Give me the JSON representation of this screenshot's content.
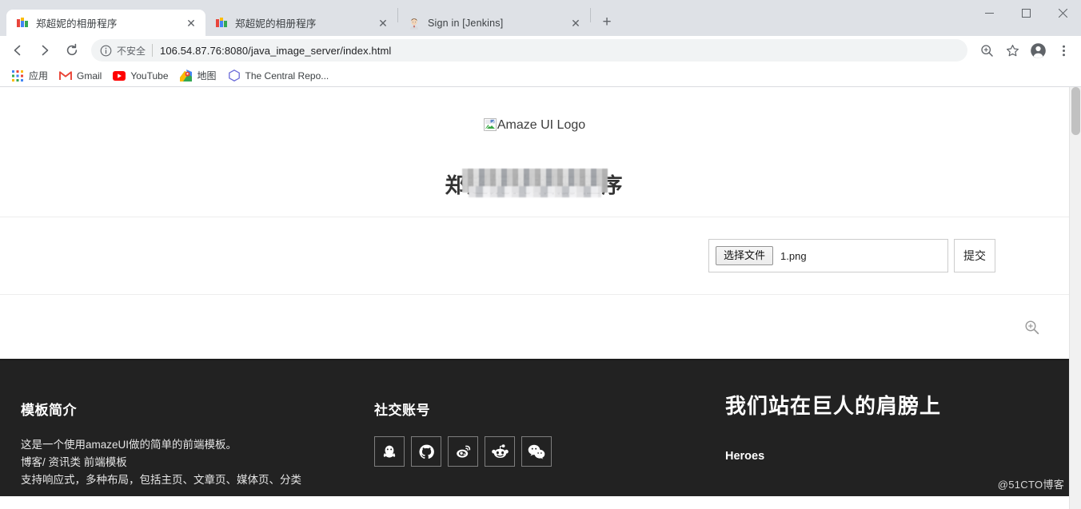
{
  "browser": {
    "tabs": [
      {
        "title": "郑超妮的相册程序",
        "favicon": "amazeui-logo-icon",
        "active": true,
        "close_label": "✕"
      },
      {
        "title": "郑超妮的相册程序",
        "favicon": "amazeui-logo-icon",
        "active": false,
        "close_label": "✕"
      },
      {
        "title": "Sign in [Jenkins]",
        "favicon": "jenkins-butler-icon",
        "active": false,
        "close_label": "✕"
      }
    ],
    "new_tab_label": "+",
    "window_controls": {
      "minimize": "minimize-icon",
      "maximize": "maximize-icon",
      "close": "close-icon"
    },
    "toolbar": {
      "back": "back-arrow-icon",
      "forward": "forward-arrow-icon",
      "reload": "reload-icon",
      "security_label": "不安全",
      "url": "106.54.87.76:8080/java_image_server/index.html",
      "zoom_icon": "zoom-in-icon",
      "bookmark_icon": "star-icon",
      "profile_icon": "profile-avatar-icon",
      "menu_icon": "three-dot-menu-icon"
    },
    "bookmarks": [
      {
        "label": "应用",
        "icon": "apps-grid-icon"
      },
      {
        "label": "Gmail",
        "icon": "gmail-icon"
      },
      {
        "label": "YouTube",
        "icon": "youtube-icon"
      },
      {
        "label": "地图",
        "icon": "google-maps-icon"
      },
      {
        "label": "The Central Repo...",
        "icon": "maven-central-icon"
      }
    ]
  },
  "page": {
    "hero": {
      "broken_image_alt": "Amaze UI Logo",
      "heading": "郑超妮的相册程序",
      "heading_redacted": true
    },
    "upload_form": {
      "choose_file_label": "选择文件",
      "file_name": "1.png",
      "submit_label": "提交"
    },
    "zoom_tool_icon": "zoom-in-icon"
  },
  "footer": {
    "col1": {
      "title": "模板简介",
      "lines": [
        "这是一个使用amazeUI做的简单的前端模板。",
        "博客/ 资讯类 前端模板",
        "支持响应式，多种布局，包括主页、文章页、媒体页、分类"
      ]
    },
    "col2": {
      "title": "社交账号",
      "socials": [
        {
          "name": "qq-icon",
          "label": "QQ"
        },
        {
          "name": "github-icon",
          "label": "GitHub"
        },
        {
          "name": "weibo-icon",
          "label": "Weibo"
        },
        {
          "name": "reddit-icon",
          "label": "Reddit"
        },
        {
          "name": "wechat-icon",
          "label": "WeChat"
        }
      ]
    },
    "col3": {
      "title": "我们站在巨人的肩膀上",
      "subtitle": "Heroes"
    }
  },
  "watermark": "@51CTO博客",
  "colors": {
    "chrome_titlebar": "#dee1e6",
    "omnibox": "#f1f3f4",
    "footer_bg": "#222222",
    "page_bg": "#ffffff"
  }
}
